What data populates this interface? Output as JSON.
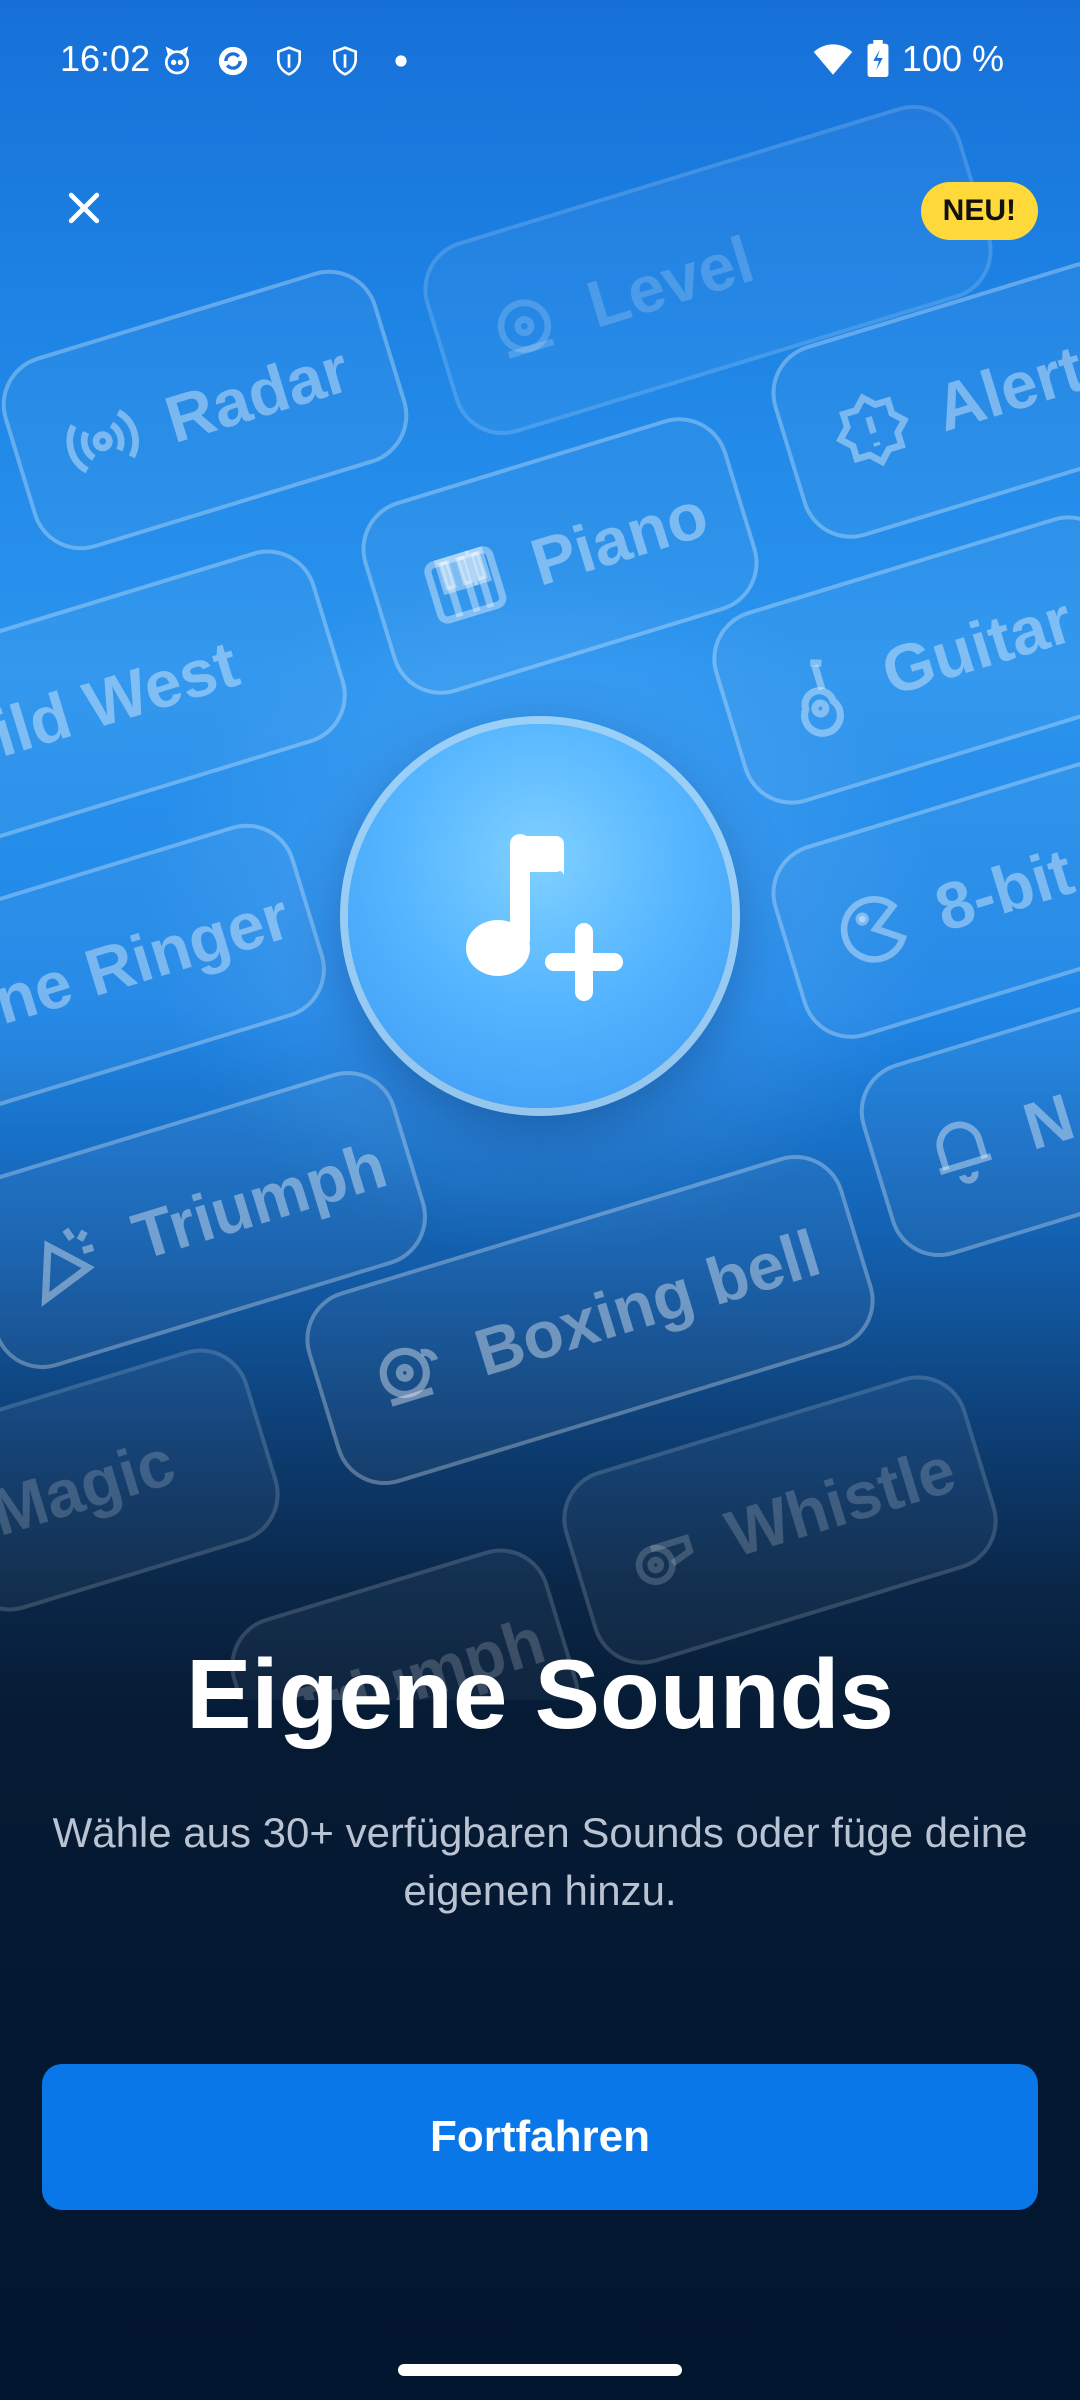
{
  "status_bar": {
    "time": "16:02",
    "battery": "100 %",
    "left_icons": [
      "cat-icon",
      "sync-icon",
      "shield-icon",
      "shield-icon",
      "dot-icon"
    ],
    "right_icons": [
      "wifi-icon",
      "battery-charging-icon"
    ]
  },
  "header": {
    "close_icon": "close-icon",
    "new_badge": "NEU!"
  },
  "chips": [
    {
      "label": "Level",
      "icon": "bell-icon"
    },
    {
      "label": "Radar",
      "icon": "radar-icon"
    },
    {
      "label": "Alert",
      "icon": "alert-icon"
    },
    {
      "label": "Piano",
      "icon": "piano-icon"
    },
    {
      "label": "Wild West",
      "icon": ""
    },
    {
      "label": "Guitar",
      "icon": "guitar-icon"
    },
    {
      "label": "Phone Ringer",
      "icon": ""
    },
    {
      "label": "8-bit",
      "icon": "pacman-icon"
    },
    {
      "label": "Triumph",
      "icon": "party-icon"
    },
    {
      "label": "N",
      "icon": "bell-icon"
    },
    {
      "label": "Boxing bell",
      "icon": "bell-icon"
    },
    {
      "label": "Magic",
      "icon": ""
    },
    {
      "label": "Whistle",
      "icon": "whistle-icon"
    },
    {
      "label": "Triumph",
      "icon": ""
    }
  ],
  "hero": {
    "icon": "music-note-plus-icon"
  },
  "main": {
    "title": "Eigene Sounds",
    "subtitle": "Wähle aus 30+ verfügbaren Sounds oder füge deine eigenen hinzu.",
    "continue_label": "Fortfahren"
  },
  "colors": {
    "accent": "#0a77e8",
    "badge": "#ffd83a",
    "background_dark": "#031630"
  }
}
